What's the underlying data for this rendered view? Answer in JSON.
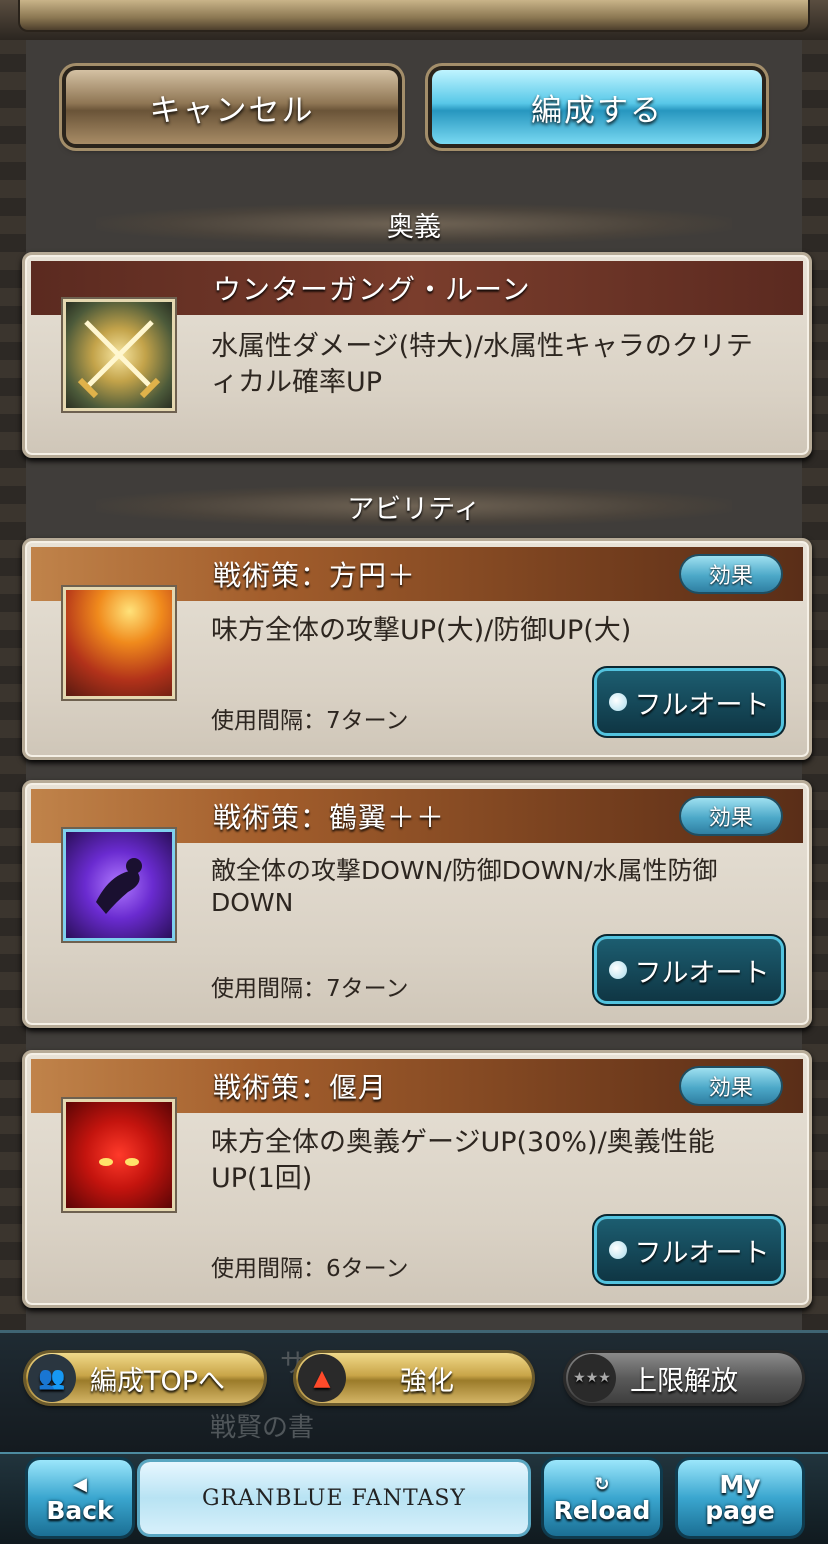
{
  "buttons": {
    "cancel": "キャンセル",
    "confirm": "編成する"
  },
  "ougi": {
    "section_title": "奥義",
    "name": "ウンターガング・ルーン",
    "description": "水属性ダメージ(特大)/水属性キャラのクリティカル確率UP",
    "icon": "crossed-swords-icon"
  },
  "abilities": {
    "section_title": "アビリティ",
    "effect_label": "効果",
    "fullauto_label": "フルオート",
    "items": [
      {
        "name": "戦術策：方円＋",
        "description": "味方全体の攻撃UP(大)/防御UP(大)",
        "interval": "使用間隔：7ターン",
        "icon": "sunburst-fire-icon"
      },
      {
        "name": "戦術策：鶴翼＋＋",
        "description": "敵全体の攻撃DOWN/防御DOWN/水属性防御DOWN",
        "interval": "使用間隔：7ターン",
        "icon": "falling-figure-icon"
      },
      {
        "name": "戦術策：偃月",
        "description": "味方全体の奥義ゲージUP(30%)/奥義性能UP(1回)",
        "interval": "使用間隔：6ターン",
        "icon": "red-demon-face-icon"
      }
    ]
  },
  "bottom_nav": {
    "party_top": "編成TOPへ",
    "enhance": "強化",
    "limit_break": "上限解放",
    "ghost_1": "サ",
    "ghost_2": "戦賢の書"
  },
  "footer": {
    "back": "Back",
    "logo": "GRANBLUE FANTASY",
    "reload": "Reload",
    "mypage_1": "My",
    "mypage_2": "page"
  }
}
